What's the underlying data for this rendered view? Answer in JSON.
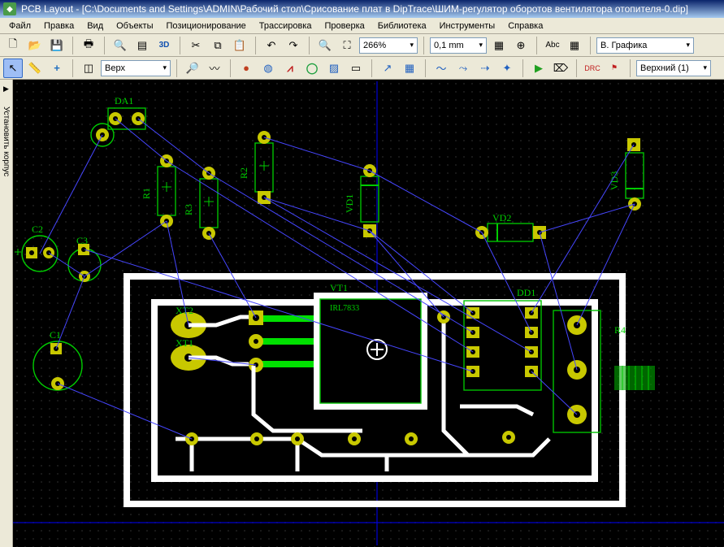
{
  "window": {
    "title": "PCB Layout - [C:\\Documents and Settings\\ADMIN\\Рабочий стол\\Срисование плат в DipTrace\\ШИМ-регулятор оборотов вентилятора отопителя-0.dip]"
  },
  "menu": {
    "file": "Файл",
    "edit": "Правка",
    "view": "Вид",
    "objects": "Объекты",
    "placement": "Позиционирование",
    "route": "Трассировка",
    "verify": "Проверка",
    "library": "Библиотека",
    "tools": "Инструменты",
    "help": "Справка"
  },
  "toolbar1": {
    "zoom_value": "266%",
    "grid_value": "0,1 mm",
    "abc_btn": "Abc",
    "display_mode": "В. Графика"
  },
  "toolbar2": {
    "layer_select": "Верх",
    "view_select": "Верхний (1)",
    "threeD": "3D"
  },
  "sidepanel": {
    "arrow": "▶",
    "label": "Установить корпус"
  },
  "refs": {
    "DA1": "DA1",
    "R1": "R1",
    "R2": "R2",
    "R3": "R3",
    "C1": "C1",
    "C2": "C2",
    "C3": "C3",
    "VD1": "VD1",
    "VD2": "VD2",
    "VD3": "VD3",
    "XT1": "XT1",
    "XT2": "XT2",
    "VT1": "VT1",
    "DD1": "DD1",
    "R4": "R4",
    "IRL": "IRL7833"
  }
}
